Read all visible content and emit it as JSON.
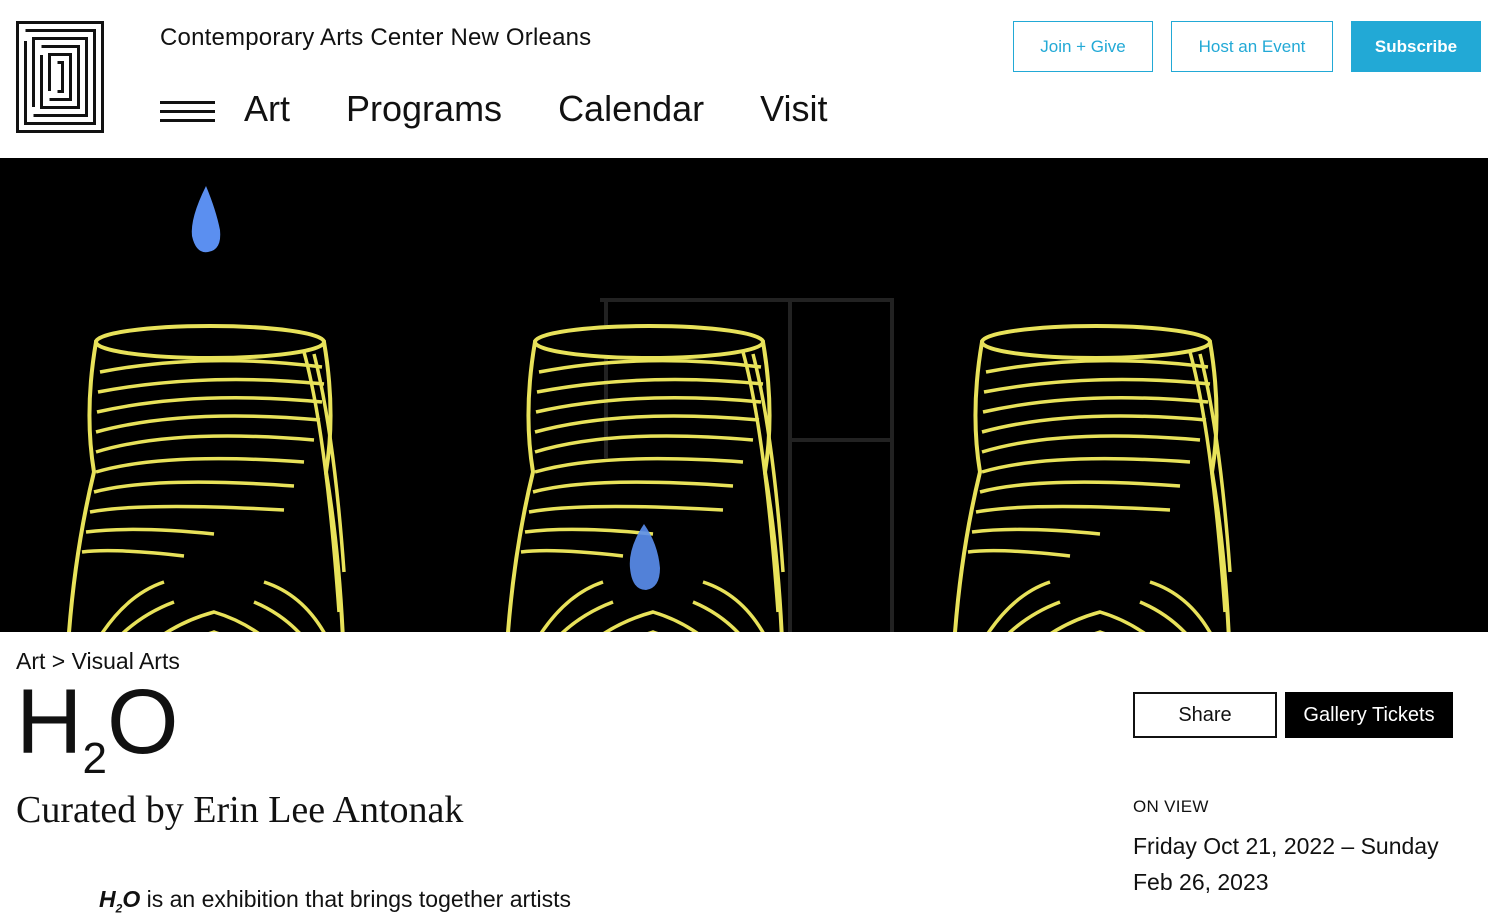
{
  "header": {
    "site_title": "Contemporary Arts Center New Orleans",
    "nav": [
      "Art",
      "Programs",
      "Calendar",
      "Visit"
    ],
    "buttons": {
      "join": "Join + Give",
      "host": "Host an Event",
      "subscribe": "Subscribe"
    }
  },
  "colors": {
    "accent": "#22a9d6",
    "hero_bg": "#000000",
    "vessel_yellow": "#e8e25a",
    "drop_blue": "#5b8ff0"
  },
  "icons": {
    "logo": "cac-maze-logo-icon",
    "menu": "hamburger-menu-icon"
  },
  "breadcrumb": {
    "parent": "Art",
    "separator": ">",
    "current": "Visual Arts"
  },
  "exhibition": {
    "title_h": "H",
    "title_sub": "2",
    "title_o": "O",
    "curator": "Curated by Erin Lee Antonak",
    "intro_h": "H",
    "intro_sub": "2",
    "intro_o": "O",
    "intro_text": " is an exhibition that brings together artists"
  },
  "actions": {
    "share": "Share",
    "tickets": "Gallery Tickets"
  },
  "on_view": {
    "label": "ON VIEW",
    "dates": "Friday Oct 21, 2022 – Sunday Feb 26, 2023"
  }
}
